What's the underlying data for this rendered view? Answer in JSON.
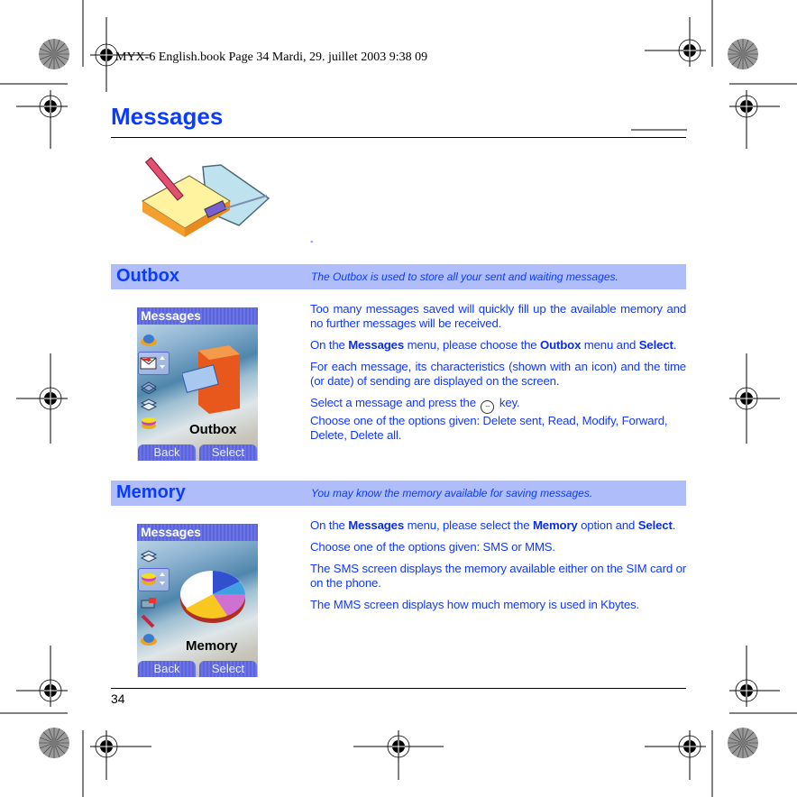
{
  "book_header": "MYX-6 English.book  Page 34  Mardi, 29. juillet 2003  9:38 09",
  "page_title": "Messages",
  "intro_mark": "-",
  "sections": [
    {
      "name": "Outbox",
      "description": "The Outbox is used to store all your sent and waiting messages.",
      "phone": {
        "title": "Messages",
        "label": "Outbox",
        "softkey_left": "Back",
        "softkey_right": "Select",
        "icons": [
          "mailbox-icon",
          "envelope-send-icon",
          "inbox-tray-icon",
          "message-stack-icon",
          "memory-disc-icon"
        ]
      },
      "paragraphs": {
        "p1": "Too many messages saved will quickly fill up the available memory and no further messages will be received.",
        "p2_a": "On the ",
        "p2_b": "Messages",
        "p2_c": " menu, please choose the ",
        "p2_d": "Outbox",
        "p2_e": " menu and ",
        "p2_f": "Select",
        "p2_g": ".",
        "p3": "For each message, its characteristics (shown with an icon) and the time (or date) of sending are displayed on the screen.",
        "p4_a": "Select a message and press the ",
        "p4_key": "--",
        "p4_b": " key.",
        "p4_c": "Choose one of the options given: Delete sent, Read, Modify, Forward, Delete, Delete all."
      }
    },
    {
      "name": "Memory",
      "description": "You may know the memory available for saving messages.",
      "phone": {
        "title": "Messages",
        "label": "Memory",
        "softkey_left": "Back",
        "softkey_right": "Select",
        "icons": [
          "message-stack-icon",
          "memory-disc-icon",
          "settings-icon",
          "pencil-icon",
          "mailbox-icon"
        ]
      },
      "paragraphs": {
        "p1_a": "On the ",
        "p1_b": "Messages",
        "p1_c": " menu, please select the ",
        "p1_d": "Memory",
        "p1_e": " option and ",
        "p1_f": "Select",
        "p1_g": ".",
        "p2": "Choose one of the options given: SMS or MMS.",
        "p3": "The SMS screen displays the memory available either on the SIM card or on the phone.",
        "p4": "The MMS screen displays how much memory is used in Kbytes."
      }
    }
  ],
  "page_number": "34",
  "colors": {
    "accent": "#0a3cff",
    "section_bar": "#b0bdfb",
    "phone_bar": "#5b64d8"
  }
}
